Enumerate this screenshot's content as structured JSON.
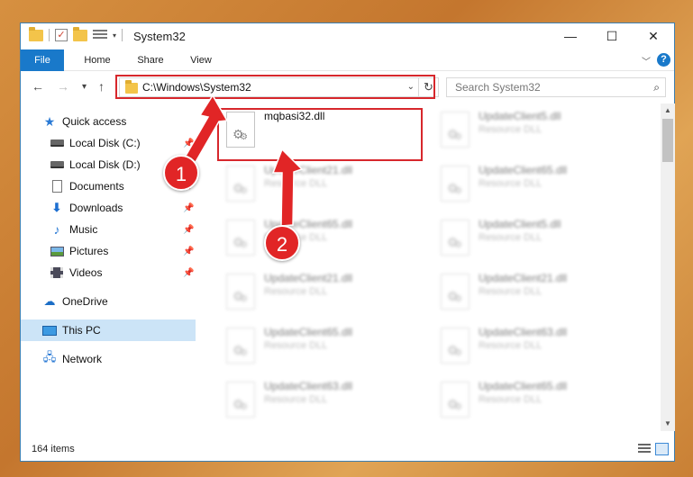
{
  "window": {
    "title": "System32",
    "controls": {
      "minimize": "—",
      "maximize": "☐",
      "close": "✕"
    }
  },
  "ribbon": {
    "tabs": [
      "File",
      "Home",
      "Share",
      "View"
    ],
    "help": "?"
  },
  "navigation": {
    "back": "←",
    "forward": "→",
    "recent": "▾",
    "up": "↑"
  },
  "address_bar": {
    "path": "C:\\Windows\\System32",
    "refresh": "↻"
  },
  "search": {
    "placeholder": "Search System32"
  },
  "sidebar": {
    "items": [
      {
        "label": "Quick access"
      },
      {
        "label": "Local Disk (C:)"
      },
      {
        "label": "Local Disk (D:)"
      },
      {
        "label": "Documents"
      },
      {
        "label": "Downloads"
      },
      {
        "label": "Music"
      },
      {
        "label": "Pictures"
      },
      {
        "label": "Videos"
      },
      {
        "label": "OneDrive"
      },
      {
        "label": "This PC"
      },
      {
        "label": "Network"
      }
    ]
  },
  "files": {
    "featured": {
      "name": "mqbasi32.dll"
    },
    "left_column": [
      {
        "name": "UpdateClient21.dll",
        "type": "Resource DLL"
      },
      {
        "name": "UpdateClient65.dll",
        "type": "Resource DLL"
      },
      {
        "name": "UpdateClient21.dll",
        "type": "Resource DLL"
      },
      {
        "name": "UpdateClient65.dll",
        "type": "Resource DLL"
      },
      {
        "name": "UpdateClient63.dll",
        "type": "Resource DLL"
      }
    ],
    "right_column": [
      {
        "name": "UpdateClient5.dll",
        "type": "Resource DLL"
      },
      {
        "name": "UpdateClient65.dll",
        "type": "Resource DLL"
      },
      {
        "name": "UpdateClient5.dll",
        "type": "Resource DLL"
      },
      {
        "name": "UpdateClient21.dll",
        "type": "Resource DLL"
      },
      {
        "name": "UpdateClient63.dll",
        "type": "Resource DLL"
      },
      {
        "name": "UpdateClient65.dll",
        "type": "Resource DLL"
      }
    ]
  },
  "status": {
    "item_count": "164 items"
  },
  "annotations": {
    "badge_1": "1",
    "badge_2": "2",
    "color": "#d7272c"
  }
}
